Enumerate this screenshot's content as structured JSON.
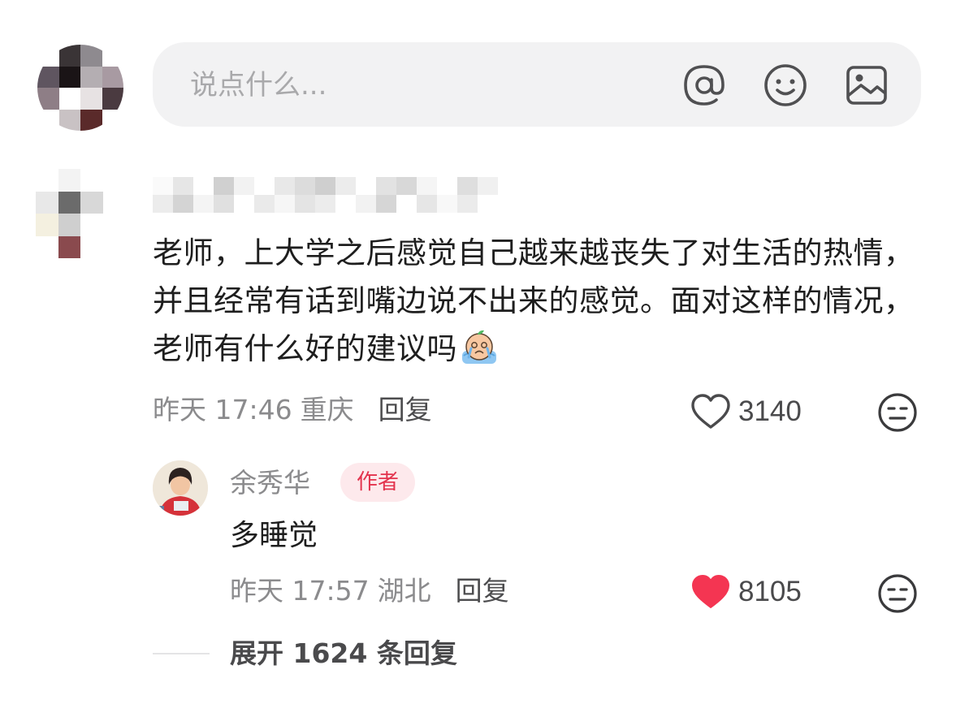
{
  "composer": {
    "placeholder": "说点什么...",
    "icons": [
      "at-icon",
      "emoji-icon",
      "image-icon"
    ]
  },
  "comment": {
    "text": "老师，上大学之后感觉自己越来越丧失了对生活的热情，并且经常有话到嘴边说不出来的感觉。面对这样的情况，老师有什么好的建议吗",
    "emoji": "crying-emoji-icon",
    "time": "昨天 17:46",
    "location": "重庆",
    "reply_label": "回复",
    "like_count": "3140",
    "liked": false
  },
  "reply": {
    "author": "余秀华",
    "badge": "作者",
    "text": "多睡觉",
    "time": "昨天 17:57",
    "location": "湖北",
    "reply_label": "回复",
    "like_count": "8105",
    "liked": true
  },
  "expand": {
    "label": "展开 1624 条回复"
  },
  "colors": {
    "like_active": "#f43552",
    "badge_text": "#e3334d",
    "badge_bg": "#fde9ec",
    "meta_text": "#8b8b8d"
  }
}
